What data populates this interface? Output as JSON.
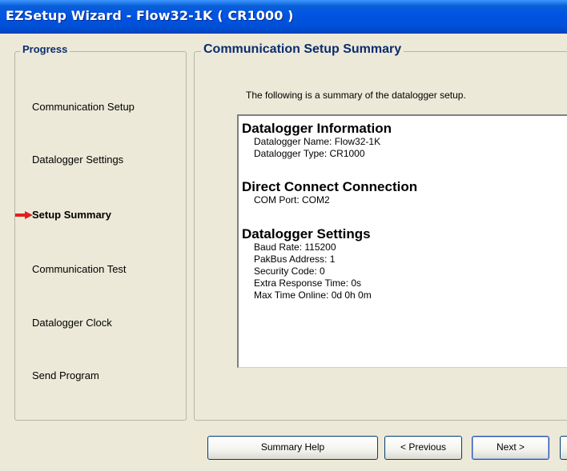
{
  "window": {
    "title": "EZSetup Wizard - Flow32-1K ( CR1000 )"
  },
  "progress": {
    "legend": "Progress",
    "steps": [
      {
        "label": "Communication Setup"
      },
      {
        "label": "Datalogger Settings"
      },
      {
        "label": "Setup Summary",
        "current": true
      },
      {
        "label": "Communication Test"
      },
      {
        "label": "Datalogger Clock"
      },
      {
        "label": "Send Program"
      }
    ]
  },
  "summary": {
    "legend": "Communication Setup Summary",
    "intro": "The following is a summary of the datalogger setup.",
    "sections": [
      {
        "title": "Datalogger Information",
        "lines": [
          "Datalogger Name: Flow32-1K",
          "Datalogger Type: CR1000"
        ]
      },
      {
        "title": "Direct Connect Connection",
        "lines": [
          "COM Port: COM2"
        ]
      },
      {
        "title": "Datalogger Settings",
        "lines": [
          "Baud Rate: 115200",
          "PakBus Address: 1",
          "Security Code: 0",
          "Extra Response Time: 0s",
          "Max Time Online: 0d 0h 0m"
        ]
      }
    ]
  },
  "buttons": {
    "help": "Summary Help",
    "previous": "< Previous",
    "next": "Next >"
  },
  "colors": {
    "title_bar": "#0054e3",
    "legend_text": "#0b2d6e",
    "current_arrow": "#e02020",
    "window_bg": "#ece9d8"
  }
}
